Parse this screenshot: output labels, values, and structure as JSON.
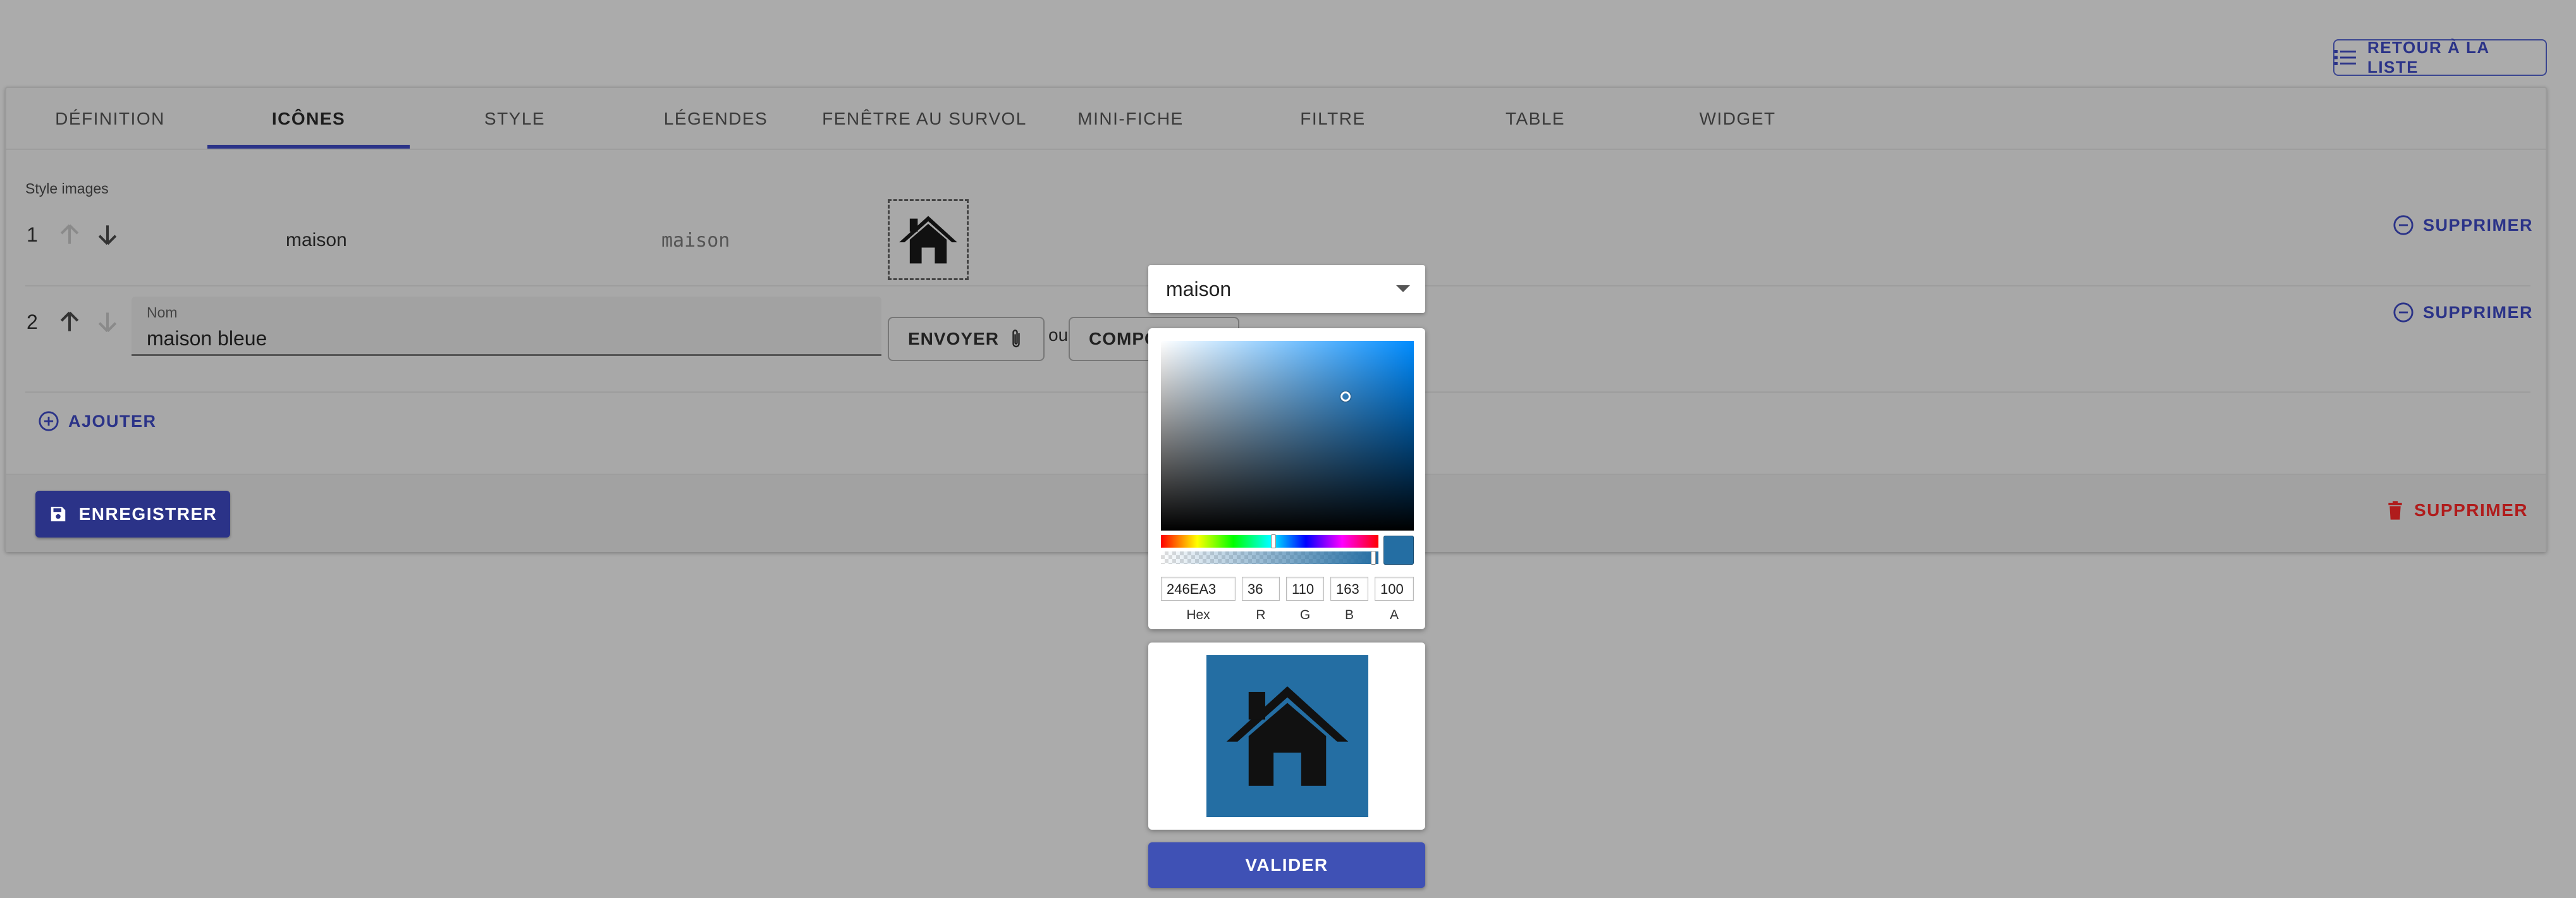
{
  "header": {
    "back_to_list_label": "RETOUR À LA LISTE",
    "back_icon": "list-icon"
  },
  "tabs": [
    {
      "label": "DÉFINITION"
    },
    {
      "label": "ICÔNES",
      "active": true
    },
    {
      "label": "STYLE"
    },
    {
      "label": "LÉGENDES"
    },
    {
      "label": "FENÊTRE AU SURVOL"
    },
    {
      "label": "MINI-FICHE"
    },
    {
      "label": "FILTRE"
    },
    {
      "label": "TABLE"
    },
    {
      "label": "WIDGET"
    }
  ],
  "section": {
    "label": "Style images"
  },
  "rows": [
    {
      "index": "1",
      "name": "maison",
      "code": "maison",
      "icon": "house-icon",
      "delete_label": "SUPPRIMER"
    },
    {
      "index": "2",
      "name_field_label": "Nom",
      "name_value": "maison bleue",
      "upload_label": "ENVOYER",
      "upload_icon": "paperclip-icon",
      "or_label": "ou",
      "compose_label": "COMPOSER",
      "delete_label": "SUPPRIMER"
    }
  ],
  "add_label": "AJOUTER",
  "footer": {
    "save_label": "ENREGISTRER",
    "delete_label": "SUPPRIMER"
  },
  "popup": {
    "select_value": "maison",
    "color": {
      "hex": "246EA3",
      "r": "36",
      "g": "110",
      "b": "163",
      "a": "100",
      "labels": {
        "hex": "Hex",
        "r": "R",
        "g": "G",
        "b": "B",
        "a": "A"
      },
      "swatch_color": "#246ea3"
    },
    "preview_icon": "house-icon",
    "validate_label": "VALIDER"
  },
  "colors": {
    "primary": "#2b3388",
    "danger": "#b01c1c",
    "accent_button": "#3f51b5"
  }
}
